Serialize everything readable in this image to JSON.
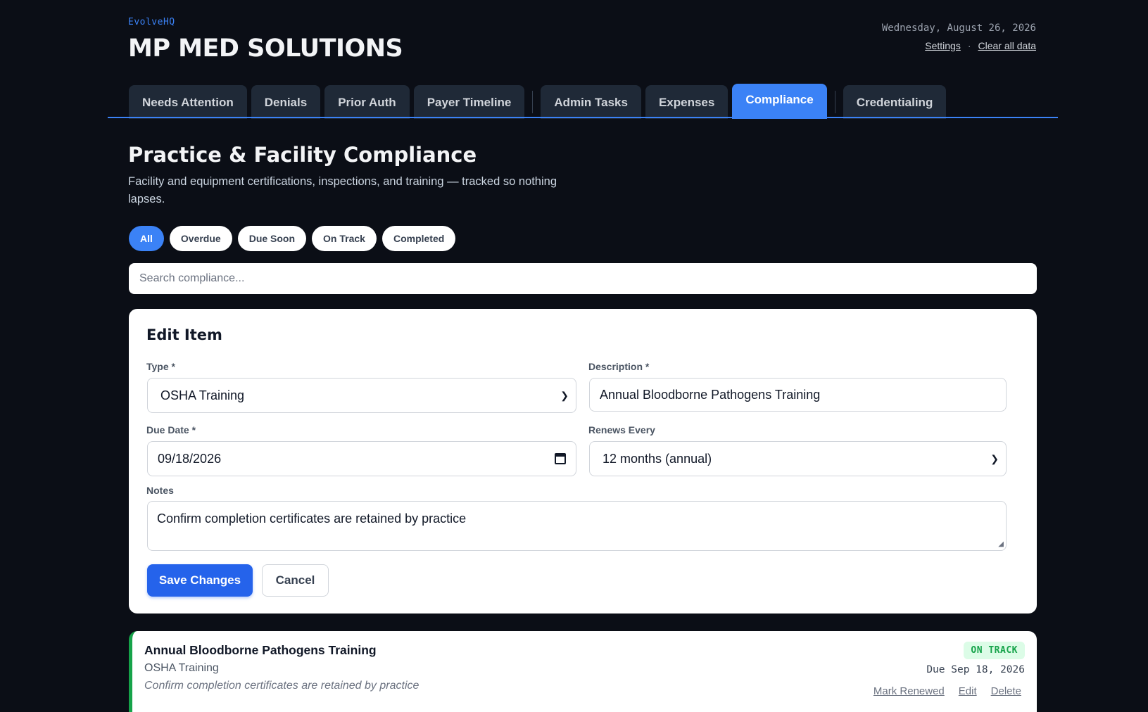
{
  "brand": {
    "kicker": "EvolveHQ",
    "title": "MP MED SOLUTIONS"
  },
  "header": {
    "date": "Wednesday, August 26, 2026",
    "settings_label": "Settings",
    "separator": "·",
    "clear_label": "Clear all data"
  },
  "tabs": [
    {
      "label": "Needs Attention"
    },
    {
      "label": "Denials"
    },
    {
      "label": "Prior Auth"
    },
    {
      "label": "Payer Timeline"
    },
    {
      "label": "Admin Tasks"
    },
    {
      "label": "Expenses"
    },
    {
      "label": "Compliance",
      "active": true
    },
    {
      "label": "Credentialing"
    }
  ],
  "page": {
    "title": "Practice & Facility Compliance",
    "subtitle": "Facility and equipment certifications, inspections, and training — tracked so nothing lapses."
  },
  "filters": [
    {
      "label": "All",
      "active": true
    },
    {
      "label": "Overdue"
    },
    {
      "label": "Due Soon"
    },
    {
      "label": "On Track"
    },
    {
      "label": "Completed"
    }
  ],
  "search": {
    "placeholder": "Search compliance..."
  },
  "edit_form": {
    "title": "Edit Item",
    "type_label": "Type *",
    "type_value": "OSHA Training",
    "description_label": "Description *",
    "description_value": "Annual Bloodborne Pathogens Training",
    "due_date_label": "Due Date *",
    "due_date_value": "09/18/2026",
    "renews_label": "Renews Every",
    "renews_value": "12 months (annual)",
    "notes_label": "Notes",
    "notes_value": "Confirm completion certificates are retained by practice",
    "save_label": "Save Changes",
    "cancel_label": "Cancel"
  },
  "item": {
    "title": "Annual Bloodborne Pathogens Training",
    "type": "OSHA Training",
    "notes": "Confirm completion certificates are retained by practice",
    "status": "ON TRACK",
    "due": "Due Sep 18, 2026",
    "mark_renewed_label": "Mark Renewed",
    "edit_label": "Edit",
    "delete_label": "Delete"
  },
  "colors": {
    "accent": "#3b82f6",
    "background": "#0b0e16",
    "on_track": "#16a34a"
  }
}
